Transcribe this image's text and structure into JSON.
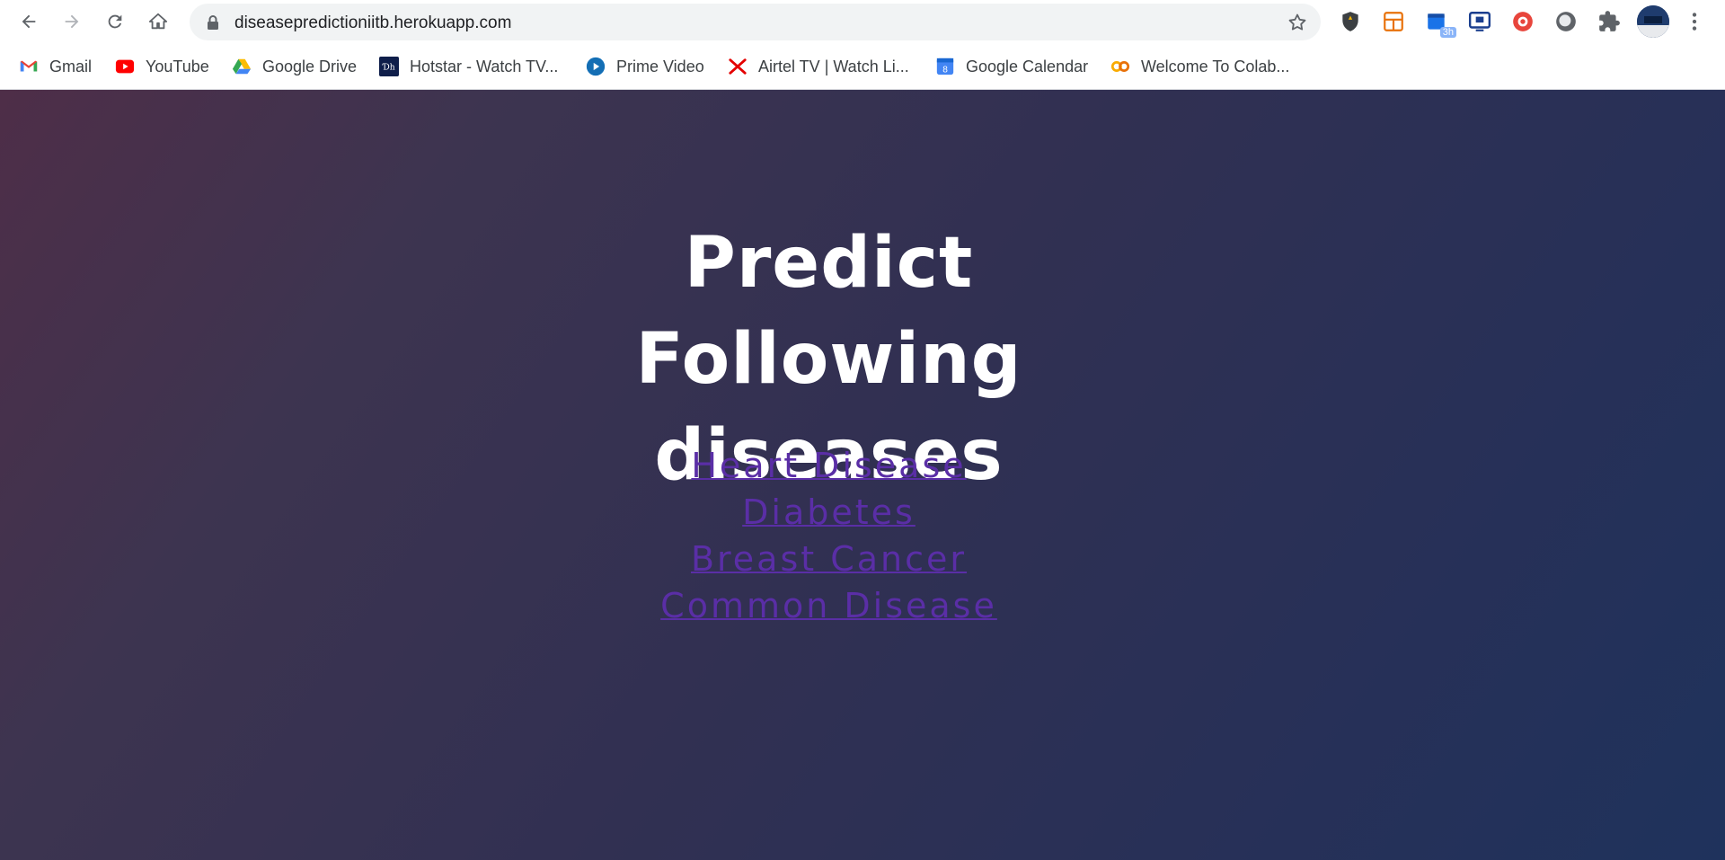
{
  "browser": {
    "url": "diseasepredictioniitb.herokuapp.com",
    "extensions": [
      {
        "icon": "shield-extension-icon",
        "color": "#3c4043"
      },
      {
        "icon": "grid-extension-icon",
        "color": "#e8710a"
      },
      {
        "icon": "calendar-extension-icon",
        "color": "#1a73e8",
        "badge": "3h"
      },
      {
        "icon": "screen-extension-icon",
        "color": "#1a3e8e"
      },
      {
        "icon": "record-extension-icon",
        "color": "#e8453c"
      },
      {
        "icon": "globe-extension-icon",
        "color": "#5f6368"
      },
      {
        "icon": "puzzle-extensions-icon",
        "color": "#5f6368"
      }
    ]
  },
  "bookmarks": [
    {
      "label": "Gmail",
      "icon": "gmail-icon"
    },
    {
      "label": "YouTube",
      "icon": "youtube-icon"
    },
    {
      "label": "Google Drive",
      "icon": "google-drive-icon"
    },
    {
      "label": "Hotstar - Watch TV...",
      "icon": "hotstar-icon"
    },
    {
      "label": "Prime Video",
      "icon": "prime-video-icon"
    },
    {
      "label": "Airtel TV | Watch Li...",
      "icon": "airtel-icon"
    },
    {
      "label": "Google Calendar",
      "icon": "google-calendar-icon"
    },
    {
      "label": "Welcome To Colab...",
      "icon": "colab-icon"
    }
  ],
  "page": {
    "title_line1": "Predict Following",
    "title_line2": "diseases",
    "links": [
      {
        "label": "Heart Disease"
      },
      {
        "label": "Diabetes"
      },
      {
        "label": "Breast Cancer"
      },
      {
        "label": "Common Disease"
      }
    ]
  },
  "colors": {
    "link": "#5a2ea6",
    "title": "#ffffff",
    "gradient_start": "#4e2e48",
    "gradient_end": "#1f325c"
  }
}
